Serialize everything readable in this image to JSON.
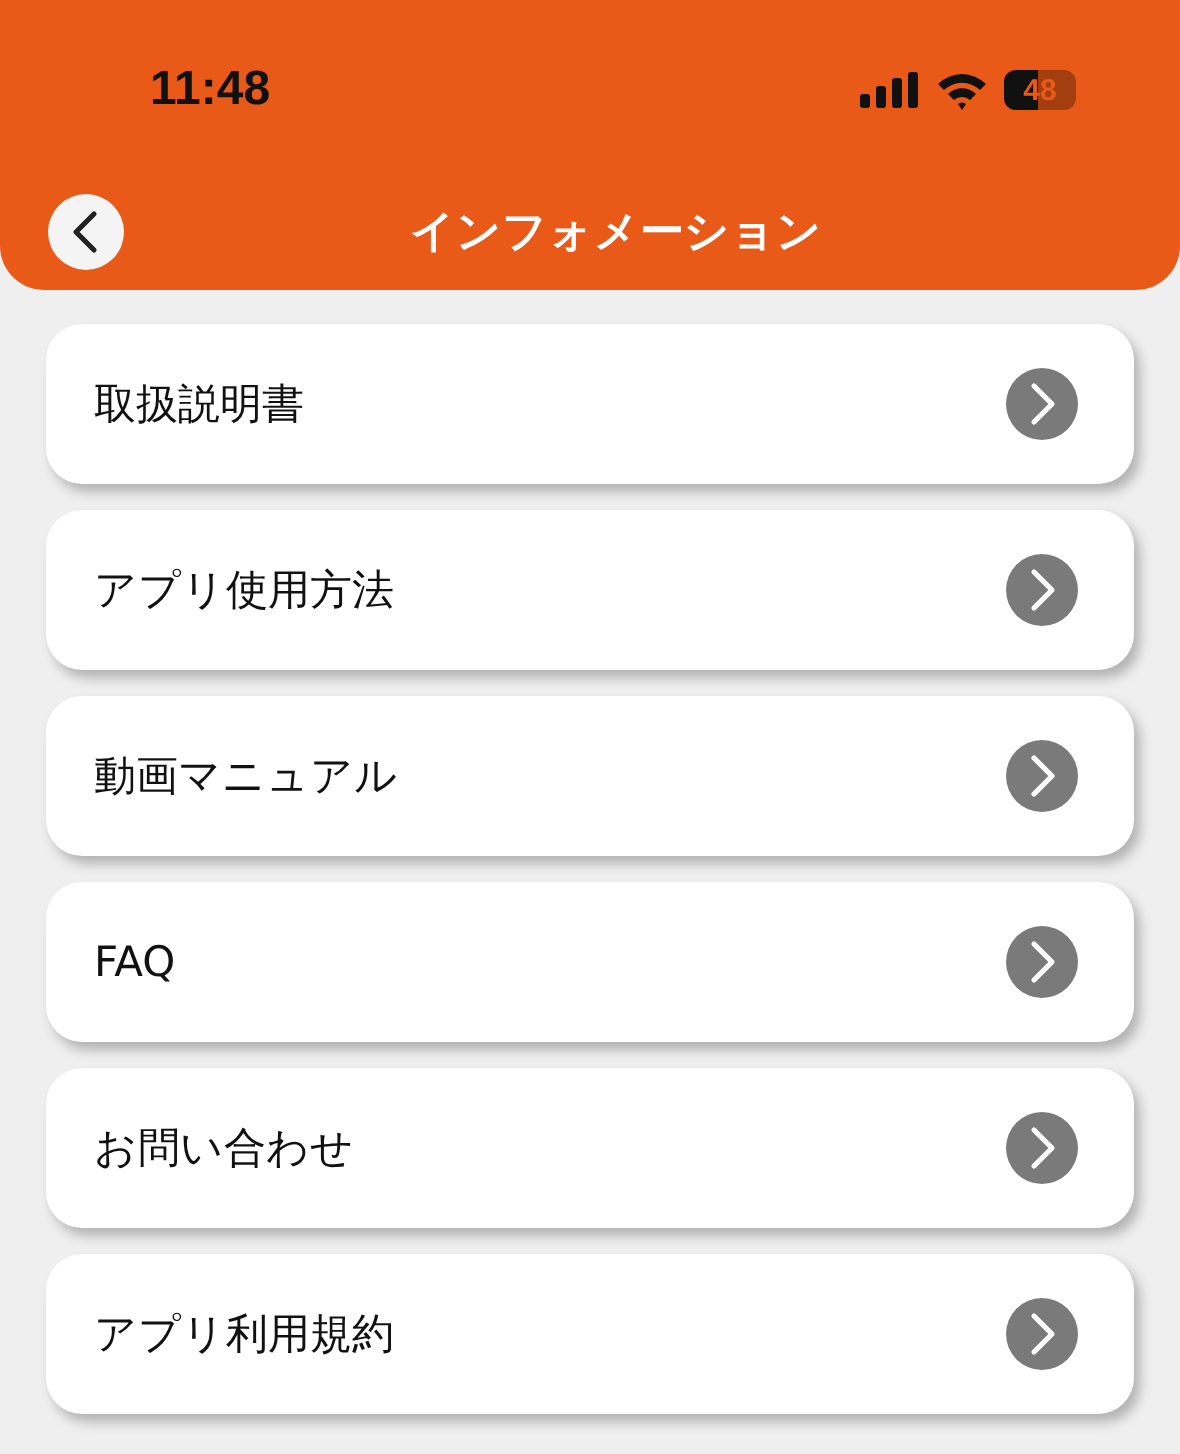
{
  "status_bar": {
    "time": "11:48",
    "battery": "48"
  },
  "header": {
    "title": "インフォメーション"
  },
  "menu_items": [
    {
      "label": "取扱説明書"
    },
    {
      "label": "アプリ使用方法"
    },
    {
      "label": "動画マニュアル"
    },
    {
      "label": "FAQ"
    },
    {
      "label": "お問い合わせ"
    },
    {
      "label": "アプリ利用規約"
    }
  ]
}
